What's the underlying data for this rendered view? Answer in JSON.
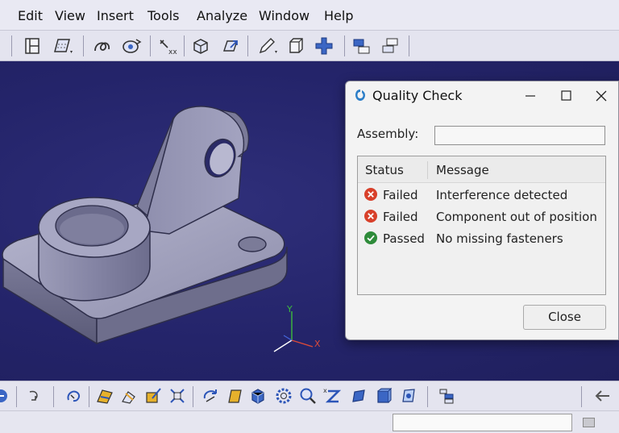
{
  "menu": {
    "items": [
      "Edit",
      "View",
      "Insert",
      "Tools",
      "Analyze",
      "Window",
      "Help"
    ]
  },
  "toolbar_icons": [
    "sketch-icon",
    "fill-icon",
    "curve-icon",
    "revolve-icon",
    "measure-icon",
    "cube-icon",
    "export-icon",
    "pencil-icon",
    "box-icon",
    "move-icon",
    "assembly-icon",
    "stack-icon"
  ],
  "bottom_toolbar_icons": [
    "undo-icon",
    "redo-icon",
    "rotate-icon",
    "material-icon",
    "walk-icon",
    "draw-icon",
    "fit-icon",
    "spin-icon",
    "face-icon",
    "cube-view-icon",
    "gear-icon",
    "zoom-icon",
    "zoom-area-icon",
    "shade-icon",
    "solid-icon",
    "render-icon",
    "tree-icon",
    "arrow-left-icon"
  ],
  "viewport": {
    "background": "#25256b",
    "axes": {
      "x": "X",
      "y": "Y"
    }
  },
  "dialog": {
    "title": "Quality Check",
    "assembly_label": "Assembly:",
    "assembly_value": "",
    "columns": {
      "status": "Status",
      "message": "Message"
    },
    "rows": [
      {
        "status": "Failed",
        "message": "Interference detected",
        "icon": "error-icon",
        "color": "#d8402a"
      },
      {
        "status": "Failed",
        "message": "Component out of position",
        "icon": "error-icon",
        "color": "#d8402a"
      },
      {
        "status": "Passed",
        "message": "No missing fasteners",
        "icon": "check-icon",
        "color": "#2e8b3a"
      }
    ],
    "close_label": "Close"
  }
}
